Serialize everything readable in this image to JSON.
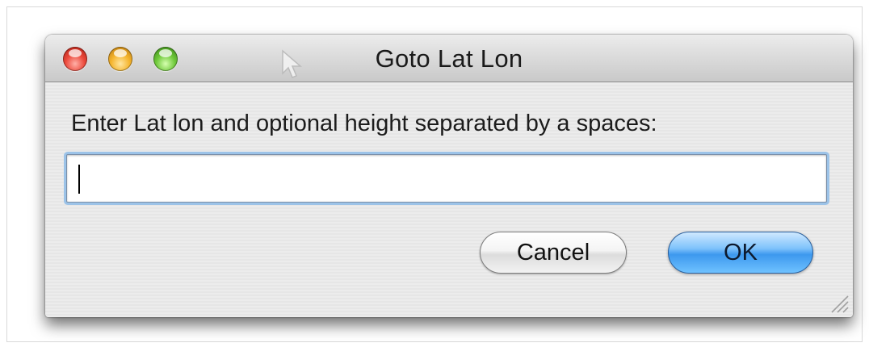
{
  "window": {
    "title": "Goto Lat Lon"
  },
  "dialog": {
    "prompt": "Enter Lat lon and optional height separated by a spaces:",
    "input_value": ""
  },
  "buttons": {
    "cancel_label": "Cancel",
    "ok_label": "OK"
  },
  "icons": {
    "close": "close-button-icon",
    "minimize": "minimize-button-icon",
    "zoom": "zoom-button-icon",
    "cursor": "mouse-pointer-icon",
    "resize": "resize-grip-icon"
  },
  "colors": {
    "close": "#ec4a3c",
    "minimize": "#f5b42c",
    "zoom": "#6fc93a",
    "default_button": "#3d98ee",
    "focus_ring": "#9cc3e8"
  }
}
